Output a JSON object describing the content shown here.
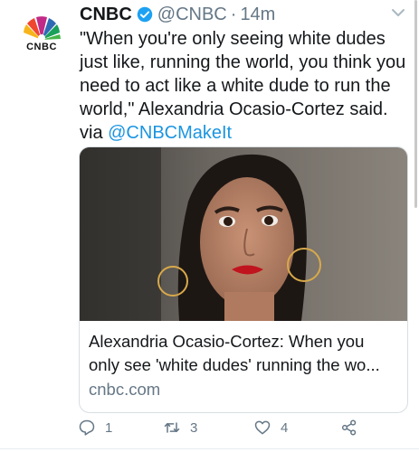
{
  "tweet": {
    "author_name": "CNBC",
    "handle": "@CNBC",
    "separator": "·",
    "time": "14m",
    "text": "\"When you're only seeing white dudes just like, running the world, you think you need to act like a white dude to run the world,\" Alexandria Ocasio-Cortez said. via ",
    "mention": "@CNBCMakeIt",
    "avatar_label": "CNBC"
  },
  "card": {
    "title": "Alexandria Ocasio-Cortez: When you\nonly see 'white dudes' running the wo...",
    "domain": "cnbc.com"
  },
  "actions": {
    "reply_count": "1",
    "retweet_count": "3",
    "like_count": "4"
  },
  "colors": {
    "accent": "#1b95e0",
    "muted": "#657786",
    "text": "#14171a",
    "border": "#d8dee2"
  },
  "icons": {
    "verified": "verified-badge-icon",
    "caret": "chevron-down-icon",
    "reply": "reply-icon",
    "retweet": "retweet-icon",
    "like": "heart-icon",
    "share": "share-icon"
  }
}
